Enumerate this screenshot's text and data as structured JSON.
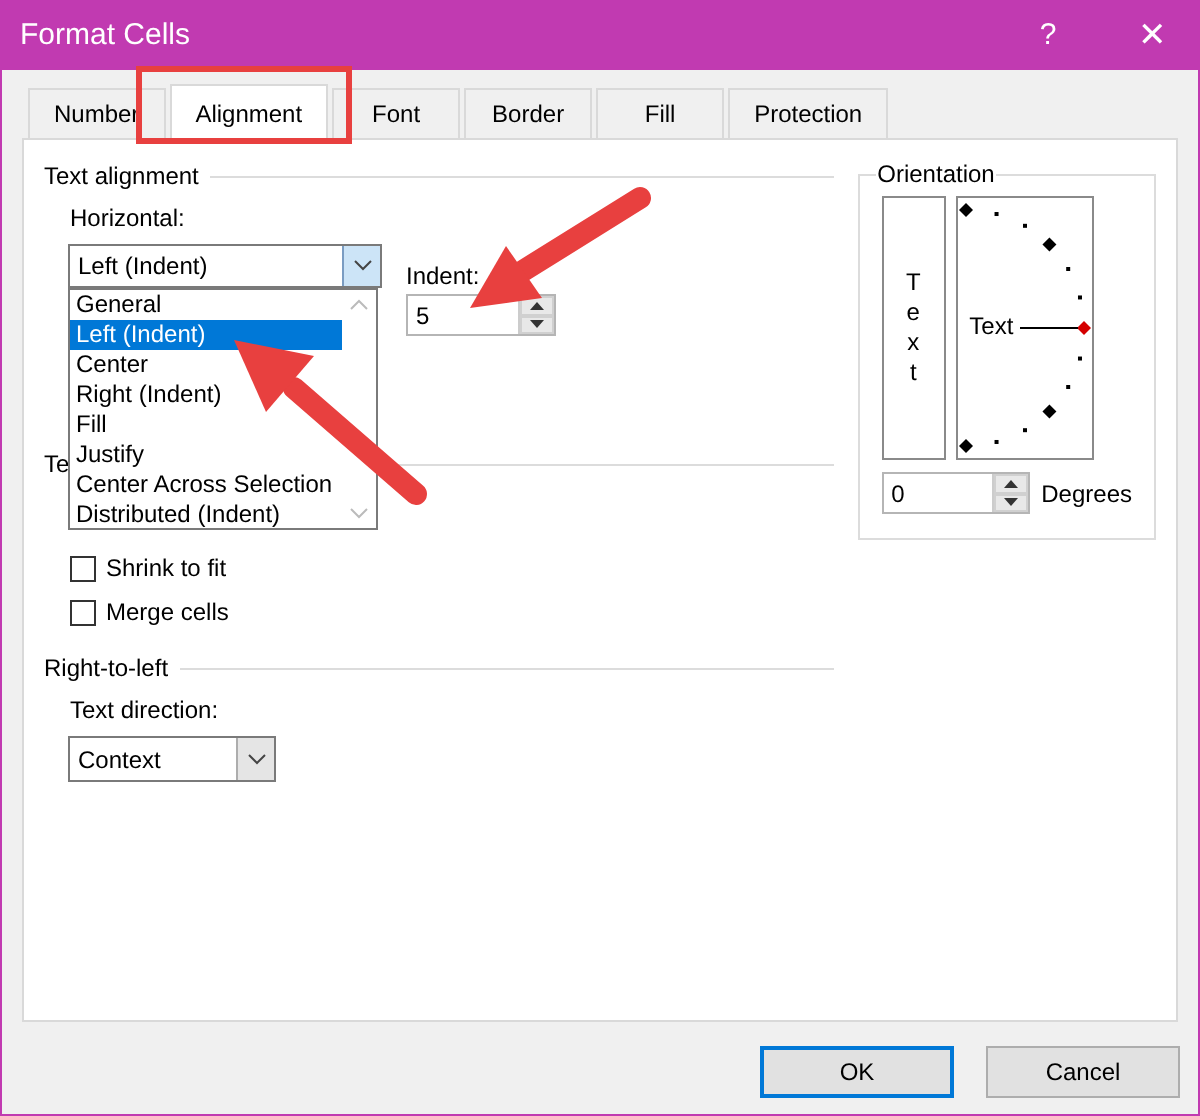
{
  "window": {
    "title": "Format Cells",
    "help": "?",
    "close": "✕"
  },
  "tabs": [
    {
      "label": "Number",
      "selected": false
    },
    {
      "label": "Alignment",
      "selected": true
    },
    {
      "label": "Font",
      "selected": false
    },
    {
      "label": "Border",
      "selected": false
    },
    {
      "label": "Fill",
      "selected": false
    },
    {
      "label": "Protection",
      "selected": false
    }
  ],
  "text_alignment": {
    "heading": "Text alignment",
    "horizontal": {
      "label": "Horizontal:",
      "value": "Left (Indent)",
      "expanded": true,
      "options": [
        {
          "label": "General",
          "selected": false
        },
        {
          "label": "Left (Indent)",
          "selected": true
        },
        {
          "label": "Center",
          "selected": false
        },
        {
          "label": "Right (Indent)",
          "selected": false
        },
        {
          "label": "Fill",
          "selected": false
        },
        {
          "label": "Justify",
          "selected": false
        },
        {
          "label": "Center Across Selection",
          "selected": false
        },
        {
          "label": "Distributed (Indent)",
          "selected": false
        }
      ]
    },
    "indent": {
      "label": "Indent:",
      "value": "5"
    }
  },
  "text_control": {
    "heading": "Te",
    "checkboxes": [
      {
        "label": "Shrink to fit",
        "checked": false
      },
      {
        "label": "Merge cells",
        "checked": false
      }
    ]
  },
  "right_to_left": {
    "heading": "Right-to-left",
    "text_direction": {
      "label": "Text direction:",
      "value": "Context"
    }
  },
  "orientation": {
    "heading": "Orientation",
    "vertical_text": "Text",
    "dial_text": "Text",
    "degrees": {
      "value": "0",
      "label": "Degrees"
    }
  },
  "buttons": [
    {
      "label": "OK",
      "default": true
    },
    {
      "label": "Cancel",
      "default": false
    }
  ]
}
